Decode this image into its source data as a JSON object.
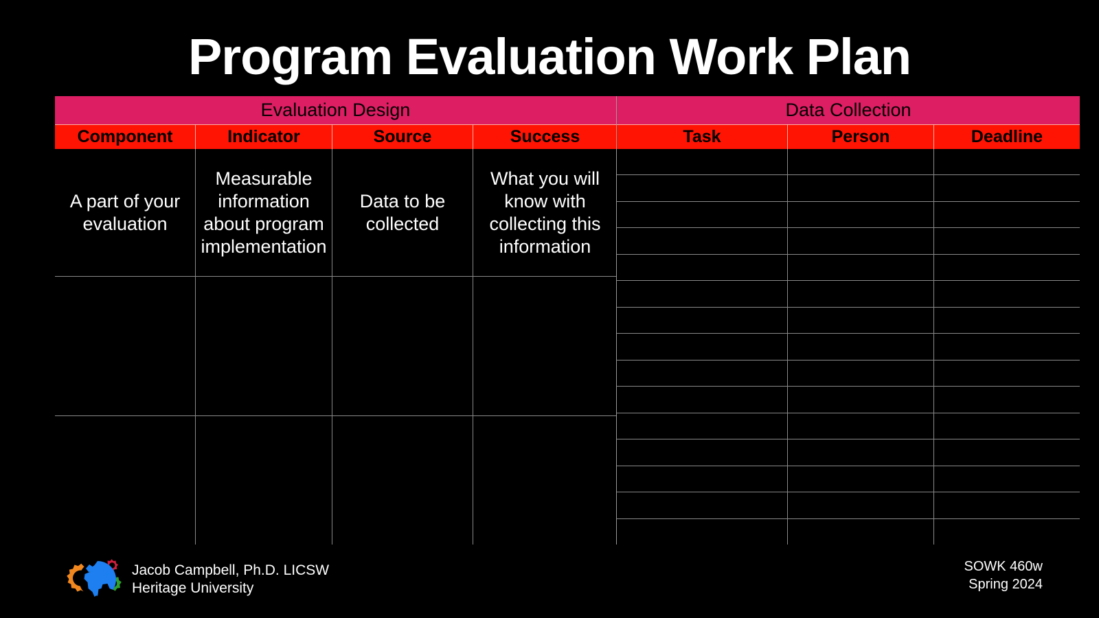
{
  "slide": {
    "title": "Program Evaluation Work Plan",
    "background_color": "#000000",
    "text_color": "#ffffff"
  },
  "colors": {
    "group_header_pink": "#dd1e63",
    "column_header_red": "#ff1404",
    "grid_line": "#8a8a8a",
    "header_text": "#000000"
  },
  "table": {
    "groups": [
      {
        "label": "Evaluation Design"
      },
      {
        "label": "Data Collection"
      }
    ],
    "evaluation_design": {
      "columns": [
        "Component",
        "Indicator",
        "Source",
        "Success"
      ],
      "rows": [
        {
          "component": "A part of your evaluation",
          "indicator": "Measurable information about program implementation",
          "source": "Data to be collected",
          "success": "What you will know with collecting this information"
        },
        {
          "component": "",
          "indicator": "",
          "source": "",
          "success": ""
        },
        {
          "component": "",
          "indicator": "",
          "source": "",
          "success": ""
        }
      ]
    },
    "data_collection": {
      "columns": [
        "Task",
        "Person",
        "Deadline"
      ],
      "row_count": 15,
      "rows": [
        {
          "task": "",
          "person": "",
          "deadline": ""
        },
        {
          "task": "",
          "person": "",
          "deadline": ""
        },
        {
          "task": "",
          "person": "",
          "deadline": ""
        },
        {
          "task": "",
          "person": "",
          "deadline": ""
        },
        {
          "task": "",
          "person": "",
          "deadline": ""
        },
        {
          "task": "",
          "person": "",
          "deadline": ""
        },
        {
          "task": "",
          "person": "",
          "deadline": ""
        },
        {
          "task": "",
          "person": "",
          "deadline": ""
        },
        {
          "task": "",
          "person": "",
          "deadline": ""
        },
        {
          "task": "",
          "person": "",
          "deadline": ""
        },
        {
          "task": "",
          "person": "",
          "deadline": ""
        },
        {
          "task": "",
          "person": "",
          "deadline": ""
        },
        {
          "task": "",
          "person": "",
          "deadline": ""
        },
        {
          "task": "",
          "person": "",
          "deadline": ""
        },
        {
          "task": "",
          "person": "",
          "deadline": ""
        }
      ]
    }
  },
  "footer": {
    "logo": {
      "name": "gears-and-globe-logo",
      "gear_left_color": "#f0881f",
      "globe_color": "#1d7ff0",
      "gear_top_right_color": "#cf1f3d",
      "gear_bottom_right_color": "#2fa12f"
    },
    "presenter_name": "Jacob Campbell, Ph.D. LICSW",
    "institution": "Heritage University",
    "course": "SOWK 460w",
    "term": "Spring 2024"
  }
}
